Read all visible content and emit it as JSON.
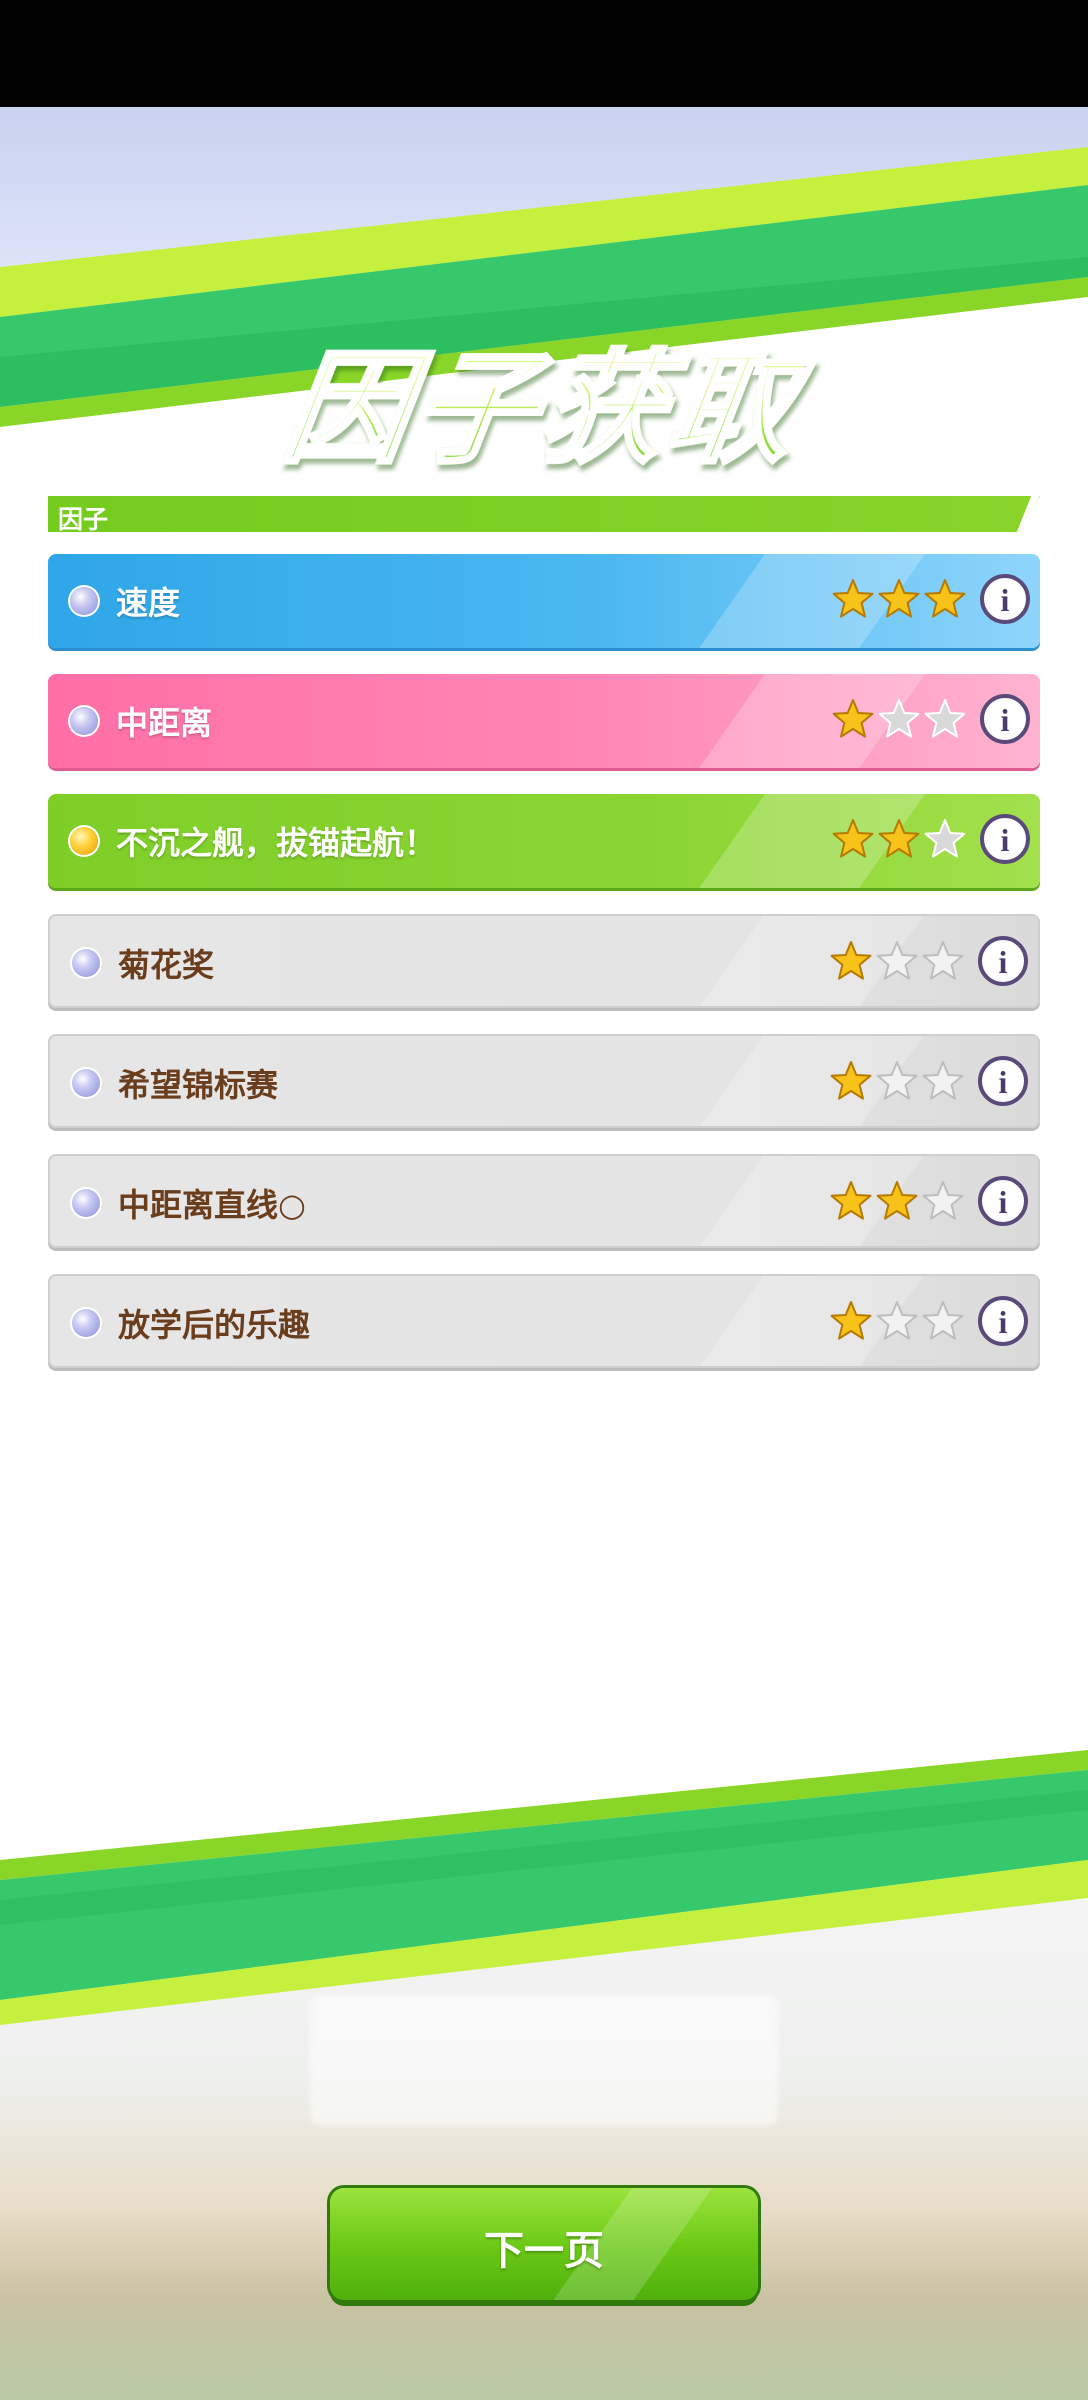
{
  "header": {
    "title": "因子获取"
  },
  "section": {
    "label": "因子"
  },
  "factors": [
    {
      "label": "速度",
      "style": "blue",
      "stars": 3,
      "max_stars": 3,
      "dot": "blue"
    },
    {
      "label": "中距离",
      "style": "pink",
      "stars": 1,
      "max_stars": 3,
      "dot": "blue"
    },
    {
      "label": "不沉之舰，拔锚起航！",
      "style": "green",
      "stars": 2,
      "max_stars": 3,
      "dot": "gold"
    },
    {
      "label": "菊花奖",
      "style": "gray",
      "stars": 1,
      "max_stars": 3,
      "dot": "blue"
    },
    {
      "label": "希望锦标赛",
      "style": "gray",
      "stars": 1,
      "max_stars": 3,
      "dot": "blue"
    },
    {
      "label": "中距离直线○",
      "style": "gray",
      "stars": 2,
      "max_stars": 3,
      "dot": "blue"
    },
    {
      "label": "放学后的乐趣",
      "style": "gray",
      "stars": 1,
      "max_stars": 3,
      "dot": "blue"
    }
  ],
  "info_icon": "info-icon",
  "footer": {
    "next_label": "下一页"
  },
  "colors": {
    "accent_green": "#7fce28",
    "blue_row": "#2fa6e8",
    "pink_row": "#ff6ea7",
    "gray_row": "#e4e4e4",
    "star_filled": "#f7c21a",
    "label_brown": "#6a3d1c"
  }
}
